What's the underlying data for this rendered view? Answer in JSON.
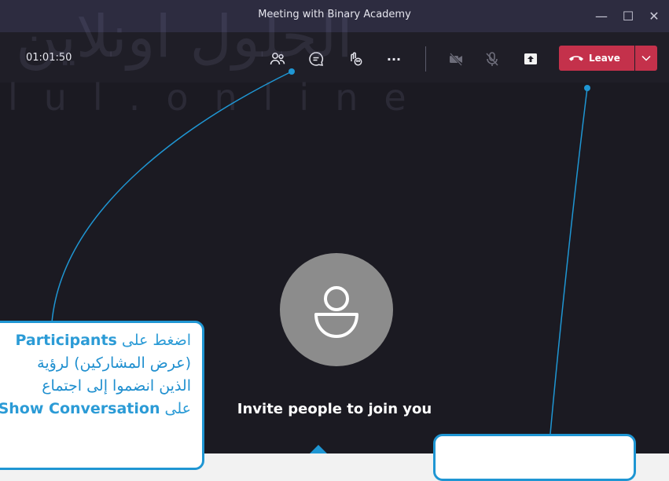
{
  "window": {
    "title": "Meeting with Binary Academy",
    "controls": {
      "minimize": "—",
      "maximize": "☐",
      "close": "✕"
    }
  },
  "toolbar": {
    "timer": "01:01:50",
    "icons": [
      "participants-icon",
      "chat-icon",
      "reactions-icon",
      "more-icon",
      "camera-off-icon",
      "mic-off-icon",
      "share-screen-icon"
    ],
    "more_label": "···",
    "leave_label": "Leave",
    "leave_color": "#c4314b"
  },
  "watermark": {
    "arabic": "الحلول اونلاين",
    "latin": "lul.online"
  },
  "stage": {
    "invite_text": "Invite people to join you"
  },
  "callouts": {
    "left": {
      "line1_prefix": "اضغط على ",
      "line1_bold": "Participants",
      "line2": "(عرض المشاركين) لرؤية",
      "line3": "الذين انضموا إلى اجتماع",
      "line4_prefix": "على ",
      "line4_bold": "Show Conversation"
    }
  },
  "colors": {
    "titlebar": "#2d2c40",
    "toolbar": "#1f1e27",
    "stage": "#1b1a22",
    "callout_border": "#1f96d3"
  }
}
